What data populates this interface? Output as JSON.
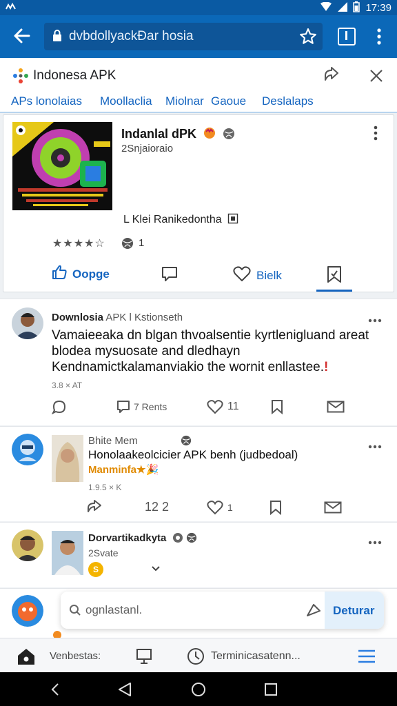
{
  "status_bar": {
    "time": "17:39",
    "notification_icon": "wave-icon"
  },
  "browser": {
    "url": "dvbdollyackĐar hosia",
    "back_icon": "arrow-left-icon",
    "lock_icon": "lock-icon",
    "star_icon": "star-icon",
    "tabs_icon": "tabs-icon",
    "menu_icon": "kebab-menu-icon"
  },
  "site": {
    "title": "Indonesa APK",
    "share_icon": "share-icon",
    "close_icon": "close-icon"
  },
  "category_tabs": [
    "APs lonolaias",
    "Moollaclia",
    "Miolnar",
    "Gaoue",
    "Deslalaps"
  ],
  "app_card": {
    "name": "Indanlal dPK",
    "subtitle": "2Snjaioraio",
    "developer": "L Klei Ranikedontha",
    "rating_text": "★★★★☆",
    "review_count": "1",
    "actions": {
      "like": "Oopge",
      "comment": "",
      "heart": "Bielk",
      "save": ""
    }
  },
  "posts": [
    {
      "author": "Downlosia",
      "author_suffix": "APK l Kstionseth",
      "body": "Vamaieeaka dn blgan thvoalsentie kyrtlenigluand areat blodea mysuosate and dledhayn Kendnamictkalamanviakio the wornit enllastee.",
      "meta": "3.8 × AT",
      "comment_count": "",
      "reply_count": "7 Rents",
      "like_count": "11"
    },
    {
      "author": "Bhite Mem",
      "body": "Honolaakeolcicier APK benh (judbedoal)",
      "highlight": "Manminfa",
      "meta": "1.9.5 × K",
      "reply_count": "12 2",
      "like_count": "1"
    },
    {
      "author": "Dorvartikadkyta",
      "sub": "2Svate",
      "coin": "S"
    }
  ],
  "compose": {
    "placeholder": "ognlastanl.",
    "send_label": "Deturar"
  },
  "bottom_nav": {
    "home_label": "Venbestas:",
    "mid_label": "Terminicasatenn...",
    "menu_icon": "list-icon"
  },
  "colors": {
    "browser_blue": "#0b68b8",
    "accent_blue": "#1565c0",
    "page_bg": "#eef1f4"
  }
}
